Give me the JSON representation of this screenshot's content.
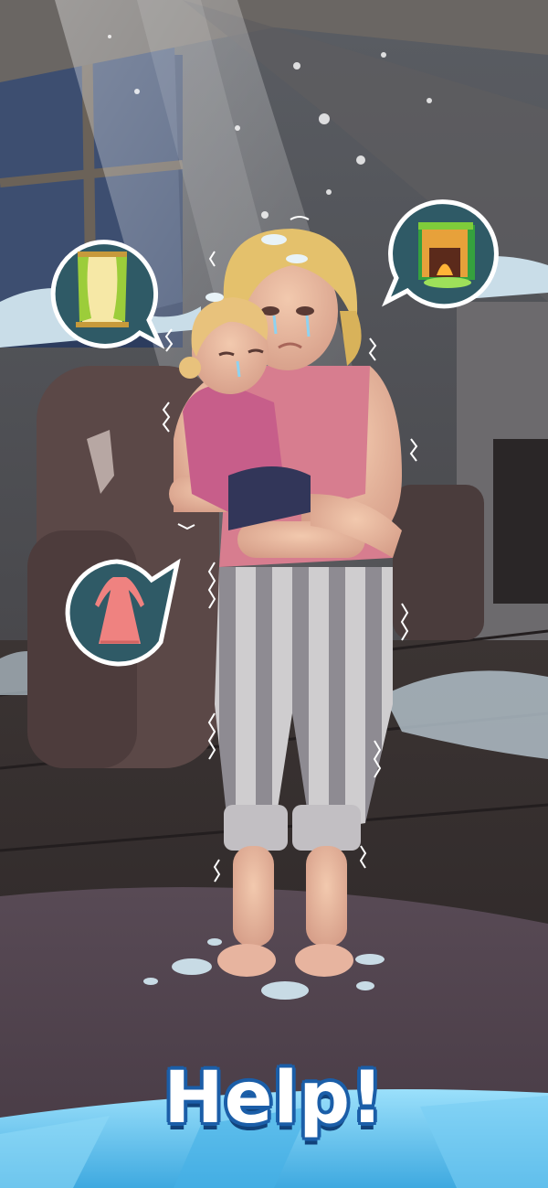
{
  "title": "Help!",
  "bubbles": [
    {
      "item": "curtains-window",
      "icon": "window-curtains-icon"
    },
    {
      "item": "fireplace",
      "icon": "fireplace-icon"
    },
    {
      "item": "pink-dress",
      "icon": "dress-icon"
    }
  ],
  "colors": {
    "bubble_border": "#ffffff",
    "bubble_fill": "#2f5a66",
    "title_fill": "#ffffff",
    "title_outline": "#1b5ea8",
    "footer_ice": "#5fc3ee"
  }
}
